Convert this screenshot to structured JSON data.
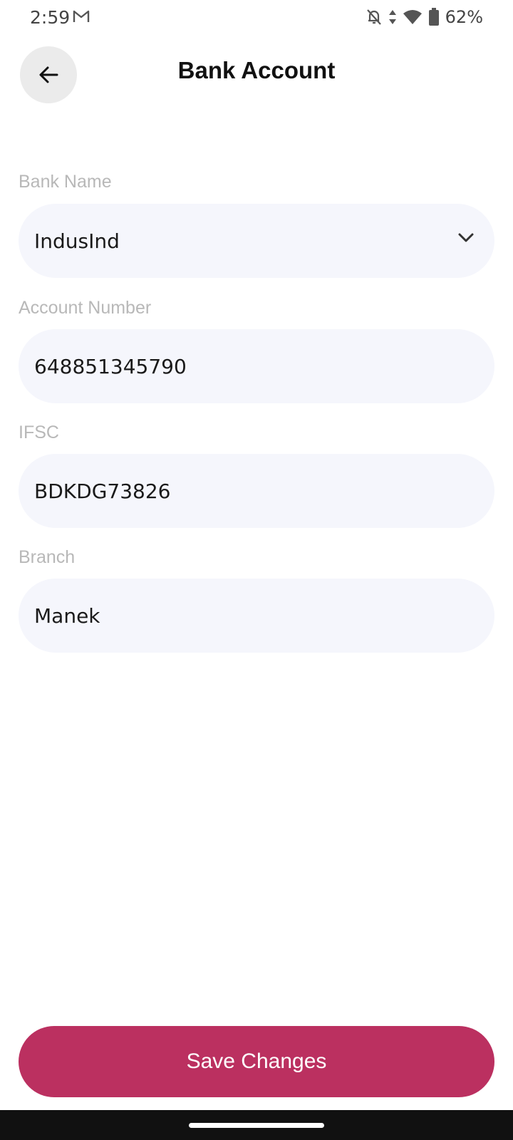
{
  "status_bar": {
    "time": "2:59",
    "battery": "62%",
    "icons": [
      "gmail-icon",
      "notifications-off-icon",
      "data-arrows-icon",
      "wifi-icon",
      "battery-icon"
    ]
  },
  "header": {
    "title": "Bank Account",
    "back_icon": "arrow-left-icon"
  },
  "form": {
    "bank_name": {
      "label": "Bank Name",
      "value": "IndusInd",
      "icon": "chevron-down-icon"
    },
    "account_number": {
      "label": "Account Number",
      "value": "648851345790"
    },
    "ifsc": {
      "label": "IFSC",
      "value": "BDKDG73826"
    },
    "branch": {
      "label": "Branch",
      "value": "Manek"
    }
  },
  "actions": {
    "save_label": "Save Changes"
  },
  "colors": {
    "accent": "#bb3060",
    "field_background": "#f5f6fc",
    "label": "#b8b8b8",
    "back_button_bg": "#ebebeb"
  }
}
